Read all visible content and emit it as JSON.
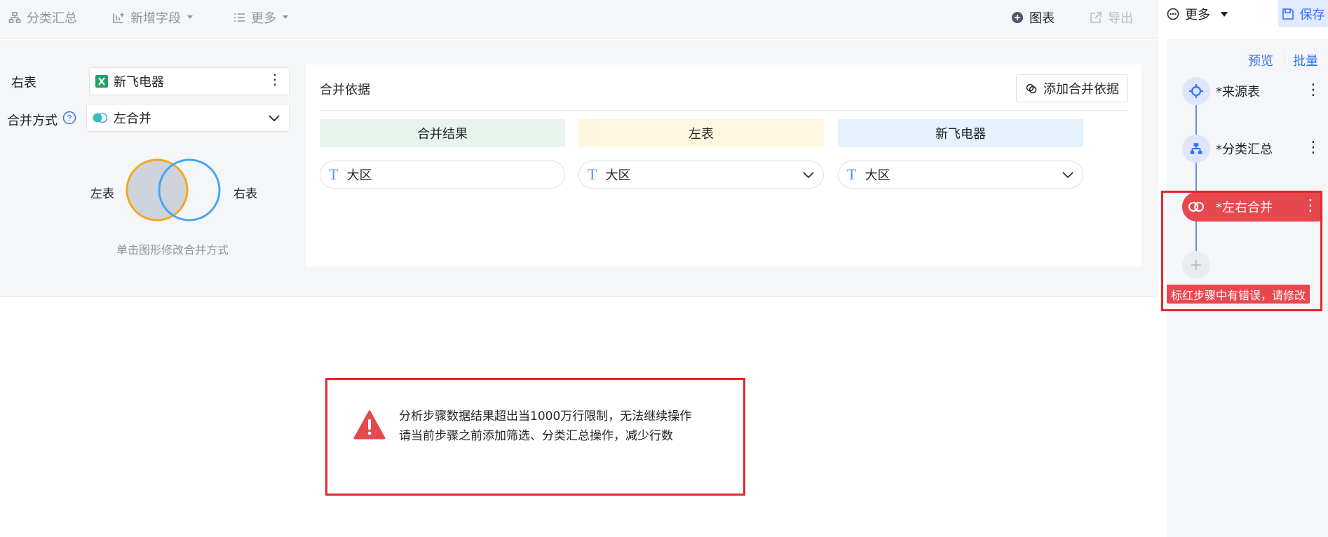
{
  "toolbar": {
    "group_summary": "分类汇总",
    "add_field": "新增字段",
    "more": "更多",
    "chart": "图表",
    "export": "导出",
    "more_right": "更多",
    "save": "保存"
  },
  "config": {
    "right_table_label": "右表",
    "right_table_value": "新飞电器",
    "merge_mode_label": "合并方式",
    "merge_mode_value": "左合并",
    "venn_left": "左表",
    "venn_right": "右表",
    "venn_hint": "单击图形修改合并方式"
  },
  "merge_basis": {
    "title": "合并依据",
    "add_button": "添加合并依据",
    "columns": [
      {
        "header": "合并结果",
        "field": "大区",
        "color": "#e8f5ec"
      },
      {
        "header": "左表",
        "field": "大区",
        "color": "#fff7e0"
      },
      {
        "header": "新飞电器",
        "field": "大区",
        "color": "#e6f2fd"
      }
    ]
  },
  "steps_panel": {
    "preview": "预览",
    "batch": "批量",
    "steps": [
      {
        "label": "*来源表",
        "icon": "source-icon",
        "status": "normal"
      },
      {
        "label": "*分类汇总",
        "icon": "group-icon",
        "status": "normal"
      },
      {
        "label": "*左右合并",
        "icon": "merge-icon",
        "status": "error"
      }
    ],
    "add_step": "+",
    "error_note": "标红步骤中有错误，请修改"
  },
  "warning": {
    "line1": "分析步骤数据结果超出当1000万行限制，无法继续操作",
    "line2": "请当前步骤之前添加筛选、分类汇总操作，减少行数"
  },
  "colors": {
    "accent": "#3370ff",
    "error": "#e5484d",
    "highlight_outline": "#e5262a",
    "venn_left": "#f5a623",
    "venn_right": "#45a6f5"
  }
}
